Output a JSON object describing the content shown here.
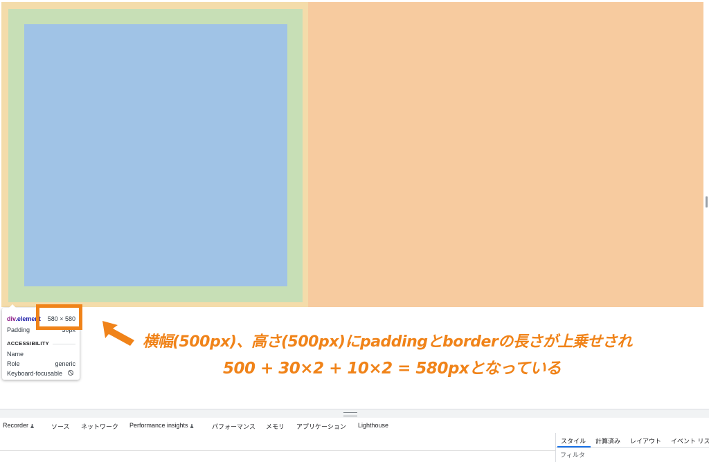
{
  "tooltip": {
    "tag": "div",
    "class": ".element",
    "dimensions": "580 × 580",
    "padding_label": "Padding",
    "padding_value": "30px",
    "accessibility_heading": "ACCESSIBILITY",
    "name_label": "Name",
    "role_label": "Role",
    "role_value": "generic",
    "keyboard_label": "Keyboard-focusable",
    "keyboard_icon": "not-allowed-icon"
  },
  "annotation": {
    "line1": "横幅(500px)、高さ(500px)にpaddingとborderの長さが上乗せされ",
    "line2": "500 + 30×2 + 10×2 = 580pxとなっている",
    "color": "#f08319"
  },
  "devtools": {
    "tabs": [
      {
        "label": "Recorder",
        "experimental": true
      },
      {
        "label": "ソース"
      },
      {
        "label": "ネットワーク"
      },
      {
        "label": "Performance insights",
        "experimental": true
      },
      {
        "label": "パフォーマンス"
      },
      {
        "label": "メモリ"
      },
      {
        "label": "アプリケーション"
      },
      {
        "label": "Lighthouse"
      }
    ],
    "side_tabs": [
      {
        "label": "スタイル",
        "active": true
      },
      {
        "label": "計算済み"
      },
      {
        "label": "レイアウト"
      },
      {
        "label": "イベント リスナー"
      }
    ],
    "filter_placeholder": "フィルタ"
  },
  "colors": {
    "margin": "#f7cb9f",
    "border": "#f4dcaa",
    "padding": "#c7dfb6",
    "content": "#a0c3e6",
    "accent": "#1a73e8"
  }
}
